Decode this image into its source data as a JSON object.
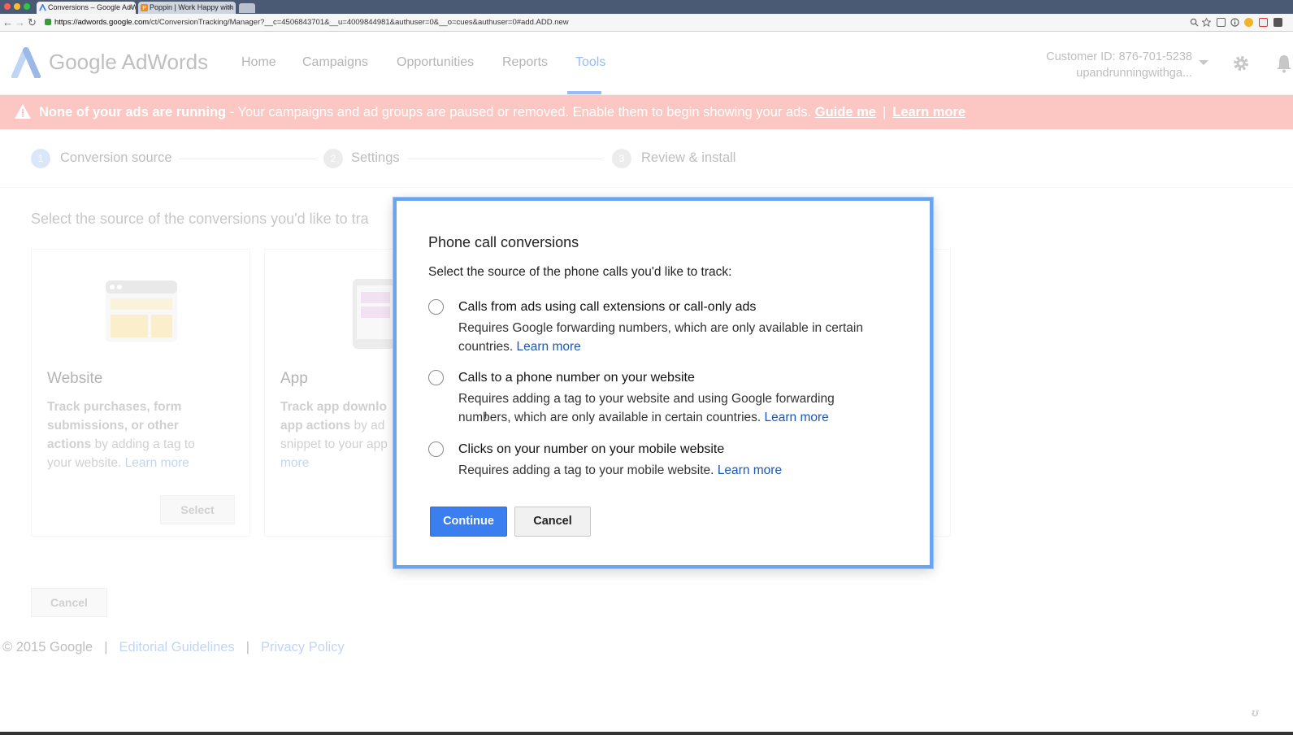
{
  "browser": {
    "tabs": [
      {
        "label": "Conversions – Google AdW",
        "active": true
      },
      {
        "label": "Poppin | Work Happy with",
        "active": false
      }
    ],
    "url_host": "https://adwords.google.com",
    "url_path": "/ct/ConversionTracking/Manager?__c=4506843701&__u=4009844981&authuser=0&__o=cues&authuser=0#add.ADD.new"
  },
  "header": {
    "logo_text": "Google AdWords",
    "nav": [
      "Home",
      "Campaigns",
      "Opportunities",
      "Reports",
      "Tools"
    ],
    "active_nav": "Tools",
    "customer_id": "Customer ID: 876-701-5238",
    "account_name": "upandrunningwithga..."
  },
  "alert": {
    "bold": "None of your ads are running",
    "message": " - Your campaigns and ad groups are paused or removed. Enable them to begin showing your ads.",
    "guide_link": "Guide me",
    "separator": "|",
    "learn_link": "Learn more"
  },
  "steps": [
    {
      "num": "1",
      "label": "Conversion source"
    },
    {
      "num": "2",
      "label": "Settings"
    },
    {
      "num": "3",
      "label": "Review & install"
    }
  ],
  "main": {
    "heading": "Select the source of the conversions you'd like to tra",
    "cards": {
      "website": {
        "title": "Website",
        "desc_bold": "Track purchases, form submissions, or other actions",
        "desc_rest": " by adding a tag to your website.",
        "link": "Learn more",
        "select_label": "Select"
      },
      "app": {
        "title": "App",
        "desc_bold": "Track app downlo",
        "desc_bold2": "app actions",
        "desc_rest": " by ad",
        "desc_rest2": "snippet to your app",
        "link": "more"
      }
    },
    "cancel_label": "Cancel"
  },
  "footer": {
    "copyright": "© 2015 Google",
    "sep": "|",
    "links": [
      "Editorial Guidelines",
      "Privacy Policy"
    ]
  },
  "dialog": {
    "title": "Phone call conversions",
    "subtitle": "Select the source of the phone calls you'd like to track:",
    "options": [
      {
        "title": "Calls from ads using call extensions or call-only ads",
        "desc": "Requires Google forwarding numbers, which are only available in certain countries.",
        "link": "Learn more"
      },
      {
        "title": "Calls to a phone number on your website",
        "desc": "Requires adding a tag to your website and using Google forwarding numbers, which are only available in certain countries.",
        "link": "Learn more"
      },
      {
        "title": "Clicks on your number on your mobile website",
        "desc": "Requires adding a tag to your mobile website.",
        "link": "Learn more"
      }
    ],
    "continue_label": "Continue",
    "cancel_label": "Cancel"
  },
  "colors": {
    "brand_blue": "#4285f4",
    "alert_bg": "#f99a90",
    "dialog_border": "#6aa3f0",
    "link": "#1a57b8"
  }
}
